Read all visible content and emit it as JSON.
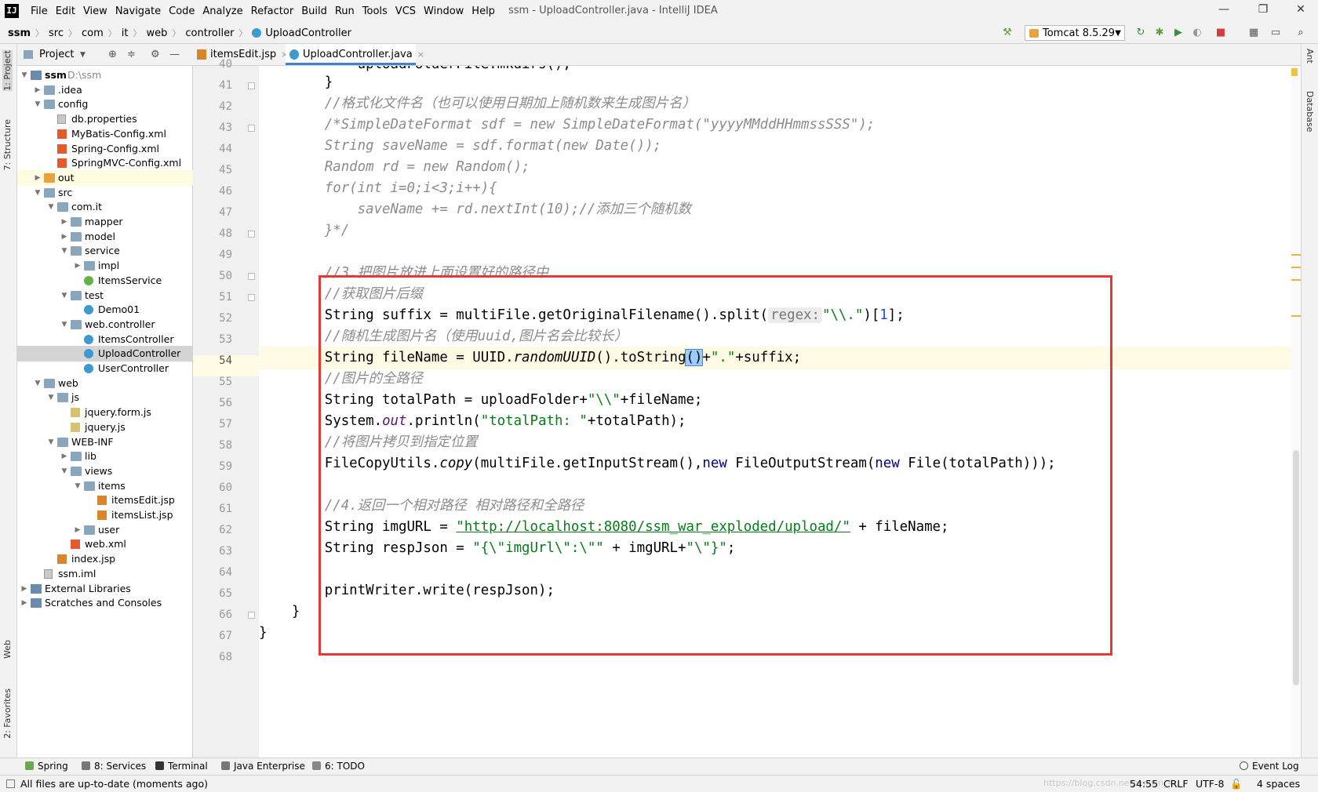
{
  "window": {
    "title": "ssm - UploadController.java - IntelliJ IDEA",
    "logo": "IJ",
    "menu": [
      "File",
      "Edit",
      "View",
      "Navigate",
      "Code",
      "Analyze",
      "Refactor",
      "Build",
      "Run",
      "Tools",
      "VCS",
      "Window",
      "Help"
    ],
    "controls": {
      "minimize": "—",
      "restore": "❐",
      "close": "✕"
    }
  },
  "breadcrumb": [
    "ssm",
    "src",
    "com",
    "it",
    "web",
    "controller",
    "UploadController"
  ],
  "toolbar": {
    "run_config": "Tomcat 8.5.29",
    "icons": [
      "hammer-icon",
      "rerun-icon",
      "debug-icon",
      "coverage-icon",
      "profile-icon",
      "stop-icon",
      "project-structure-icon",
      "layout-icon",
      "search-icon"
    ]
  },
  "left_stripe": {
    "project": "1: Project",
    "structure": "7: Structure",
    "web": "Web",
    "favorites": "2: Favorites"
  },
  "right_stripe": {
    "ant": "Ant",
    "database": "Database"
  },
  "project_panel": {
    "title": "Project"
  },
  "tree": [
    {
      "label": "ssm",
      "extra": "D:\\ssm",
      "depth": 0,
      "arrow": "▼",
      "icon": "proj"
    },
    {
      "label": ".idea",
      "depth": 1,
      "arrow": "▶",
      "icon": "folder"
    },
    {
      "label": "config",
      "depth": 1,
      "arrow": "▼",
      "icon": "folder"
    },
    {
      "label": "db.properties",
      "depth": 2,
      "arrow": "",
      "icon": "file"
    },
    {
      "label": "MyBatis-Config.xml",
      "depth": 2,
      "arrow": "",
      "icon": "xml"
    },
    {
      "label": "Spring-Config.xml",
      "depth": 2,
      "arrow": "",
      "icon": "xml"
    },
    {
      "label": "SpringMVC-Config.xml",
      "depth": 2,
      "arrow": "",
      "icon": "xml"
    },
    {
      "label": "out",
      "depth": 1,
      "arrow": "▶",
      "icon": "orange",
      "hl": true
    },
    {
      "label": "src",
      "depth": 1,
      "arrow": "▼",
      "icon": "folder"
    },
    {
      "label": "com.it",
      "depth": 2,
      "arrow": "▼",
      "icon": "folder"
    },
    {
      "label": "mapper",
      "depth": 3,
      "arrow": "▶",
      "icon": "folder"
    },
    {
      "label": "model",
      "depth": 3,
      "arrow": "▶",
      "icon": "folder"
    },
    {
      "label": "service",
      "depth": 3,
      "arrow": "▼",
      "icon": "folder"
    },
    {
      "label": "impl",
      "depth": 4,
      "arrow": "▶",
      "icon": "folder"
    },
    {
      "label": "ItemsService",
      "depth": 4,
      "arrow": "",
      "icon": "iface"
    },
    {
      "label": "test",
      "depth": 3,
      "arrow": "▼",
      "icon": "folder"
    },
    {
      "label": "Demo01",
      "depth": 4,
      "arrow": "",
      "icon": "class"
    },
    {
      "label": "web.controller",
      "depth": 3,
      "arrow": "▼",
      "icon": "folder"
    },
    {
      "label": "ItemsController",
      "depth": 4,
      "arrow": "",
      "icon": "class"
    },
    {
      "label": "UploadController",
      "depth": 4,
      "arrow": "",
      "icon": "class",
      "sel": true
    },
    {
      "label": "UserController",
      "depth": 4,
      "arrow": "",
      "icon": "class"
    },
    {
      "label": "web",
      "depth": 1,
      "arrow": "▼",
      "icon": "folder"
    },
    {
      "label": "js",
      "depth": 2,
      "arrow": "▼",
      "icon": "folder"
    },
    {
      "label": "jquery.form.js",
      "depth": 3,
      "arrow": "",
      "icon": "js"
    },
    {
      "label": "jquery.js",
      "depth": 3,
      "arrow": "",
      "icon": "js"
    },
    {
      "label": "WEB-INF",
      "depth": 2,
      "arrow": "▼",
      "icon": "folder"
    },
    {
      "label": "lib",
      "depth": 3,
      "arrow": "▶",
      "icon": "folder"
    },
    {
      "label": "views",
      "depth": 3,
      "arrow": "▼",
      "icon": "folder"
    },
    {
      "label": "items",
      "depth": 4,
      "arrow": "▼",
      "icon": "folder"
    },
    {
      "label": "itemsEdit.jsp",
      "depth": 5,
      "arrow": "",
      "icon": "jsp"
    },
    {
      "label": "itemsList.jsp",
      "depth": 5,
      "arrow": "",
      "icon": "jsp"
    },
    {
      "label": "user",
      "depth": 4,
      "arrow": "▶",
      "icon": "folder"
    },
    {
      "label": "web.xml",
      "depth": 3,
      "arrow": "",
      "icon": "xml"
    },
    {
      "label": "index.jsp",
      "depth": 2,
      "arrow": "",
      "icon": "jsp"
    },
    {
      "label": "ssm.iml",
      "depth": 1,
      "arrow": "",
      "icon": "file"
    },
    {
      "label": "External Libraries",
      "depth": 0,
      "arrow": "▶",
      "icon": "lib"
    },
    {
      "label": "Scratches and Consoles",
      "depth": 0,
      "arrow": "▶",
      "icon": "lib"
    }
  ],
  "tabs": [
    {
      "label": "itemsEdit.jsp",
      "close": "×"
    },
    {
      "label": "UploadController.java",
      "close": "×"
    }
  ],
  "editor": {
    "line_numbers": [
      "40",
      "41",
      "42",
      "43",
      "44",
      "45",
      "46",
      "47",
      "48",
      "49",
      "50",
      "51",
      "52",
      "53",
      "54",
      "55",
      "56",
      "57",
      "58",
      "59",
      "60",
      "61",
      "62",
      "63",
      "64",
      "65",
      "66",
      "67",
      "68"
    ],
    "current_line_number": "54",
    "code": {
      "l40": "            uploadFolderFile.mkdirs();",
      "l41": "        }",
      "l42": "        //格式化文件名（也可以使用日期加上随机数来生成图片名）",
      "l43": "        /*SimpleDateFormat sdf = new SimpleDateFormat(\"yyyyMMddHHmmssSSS\");",
      "l44": "        String saveName = sdf.format(new Date());",
      "l45": "        Random rd = new Random();",
      "l46": "        for(int i=0;i<3;i++){",
      "l47": "            saveName += rd.nextInt(10);//添加三个随机数",
      "l48": "        }*/",
      "l50": "        //3.把图片放进上面设置好的路径中",
      "l51": "        //获取图片后缀",
      "l52a": "        String suffix = multiFile.getOriginalFilename().split(",
      "l52hint": "regex:",
      "l52b": "\"\\\\.\"",
      "l52c": ")[",
      "l52d": "1",
      "l52e": "];",
      "l53": "        //随机生成图片名（使用uuid,图片名会比较长）",
      "l54a": "        String fileName = UUID.",
      "l54b": "randomUUID",
      "l54c": "().toString",
      "l54d": "()",
      "l54e": "+",
      "l54f": "\".\"",
      "l54g": "+suffix;",
      "l55": "        //图片的全路径",
      "l56a": "        String totalPath = uploadFolder+",
      "l56b": "\"\\\\\"",
      "l56c": "+fileName;",
      "l57a": "        System.",
      "l57b": "out",
      "l57c": ".println(",
      "l57d": "\"totalPath: \"",
      "l57e": "+totalPath);",
      "l58": "        //将图片拷贝到指定位置",
      "l59a": "        FileCopyUtils.",
      "l59b": "copy",
      "l59c": "(multiFile.getInputStream(),",
      "l59d": "new",
      "l59e": " FileOutputStream(",
      "l59f": "new",
      "l59g": " File(totalPath)));",
      "l61": "        //4.返回一个相对路径 相对路径和全路径",
      "l62a": "        String imgURL = ",
      "l62b": "\"http://localhost:8080/ssm_war_exploded/upload/\"",
      "l62c": " + fileName;",
      "l63a": "        String respJson = ",
      "l63b": "\"{\\\"imgUrl\\\":\\\"\"",
      "l63c": " + imgURL+",
      "l63d": "\"\\\"}\"",
      "l63e": ";",
      "l65": "        printWriter.write(respJson);",
      "l66": "    }",
      "l67": "}"
    }
  },
  "bottom_tools": [
    "Spring",
    "8: Services",
    "Terminal",
    "Java Enterprise",
    "6: TODO"
  ],
  "event_log": "Event Log",
  "status": {
    "message": "All files are up-to-date (moments ago)",
    "position": "54:55",
    "line_sep": "CRLF",
    "encoding": "UTF-8",
    "indent": "4 spaces",
    "watermark": "https://blog.csdn.net/weixin_4..."
  },
  "colors": {
    "annotation_box": "#e53935",
    "keyword": "#000080",
    "string": "#067d17",
    "comment": "#8c8c8c"
  }
}
